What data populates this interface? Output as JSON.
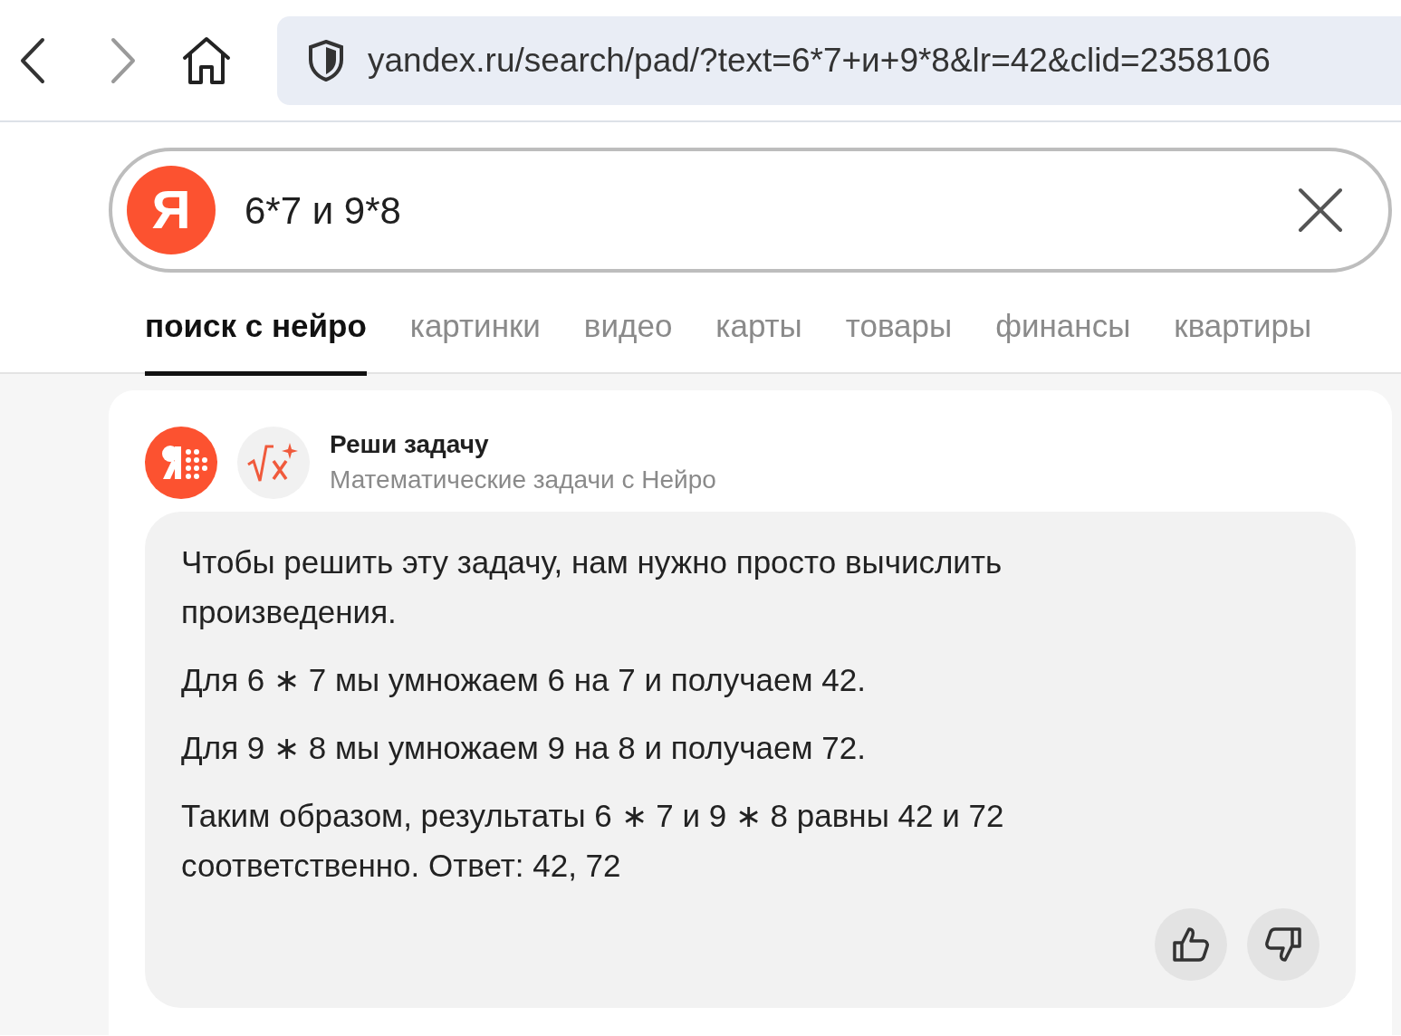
{
  "browser": {
    "url": "yandex.ru/search/pad/?text=6*7+и+9*8&lr=42&clid=2358106"
  },
  "search": {
    "logo": "Я",
    "query": "6*7 и 9*8"
  },
  "tabs": [
    {
      "label": "поиск с нейро",
      "selected": true
    },
    {
      "label": "картинки",
      "selected": false
    },
    {
      "label": "видео",
      "selected": false
    },
    {
      "label": "карты",
      "selected": false
    },
    {
      "label": "товары",
      "selected": false
    },
    {
      "label": "финансы",
      "selected": false
    },
    {
      "label": "квартиры",
      "selected": false
    }
  ],
  "card": {
    "title": "Реши задачу",
    "subtitle": "Математические задачи с Нейро",
    "paragraphs": [
      "Чтобы решить эту задачу, нам нужно просто вычислить произведения.",
      "Для 6 ∗ 7 мы умножаем 6 на 7 и получаем 42.",
      "Для 9 ∗ 8 мы умножаем 9 на 8 и получаем 72.",
      "Таким образом, результаты 6 ∗ 7 и 9 ∗ 8 равны 42 и 72 соответственно. Ответ: 42, 72"
    ]
  }
}
